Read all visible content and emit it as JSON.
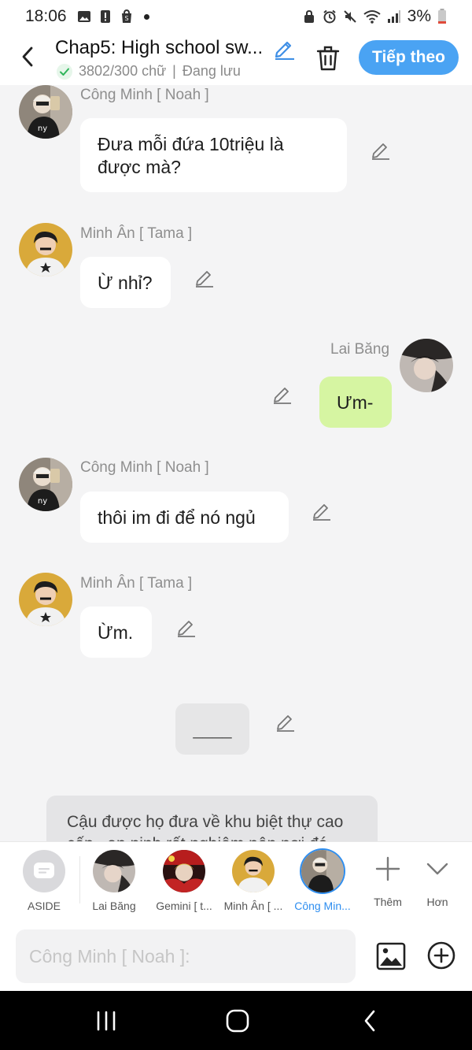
{
  "status_bar": {
    "time": "18:06",
    "battery": "3%"
  },
  "header": {
    "title": "Chap5: High school sw...",
    "word_count": "3802/300 chữ",
    "separator": "|",
    "save_status": "Đang lưu",
    "next_label": "Tiếp theo"
  },
  "messages": [
    {
      "sender": "Công Minh [ Noah ]",
      "text_line1": "Đưa mỗi đứa 10triệu là",
      "text_line2": "được mà?"
    },
    {
      "sender": "Minh Ân [ Tama ]",
      "text": "Ừ nhỉ?"
    },
    {
      "sender": "Lai Băng",
      "text": "Ưm-"
    },
    {
      "sender": "Công Minh [ Noah ]",
      "text": "thôi im đi để nó ngủ"
    },
    {
      "sender": "Minh Ân [ Tama ]",
      "text": "Ừm."
    },
    {
      "text": "____"
    }
  ],
  "aside": {
    "line1": "Cậu được họ đưa về khu biệt thự cao",
    "line2": "cấp , an ninh rất nghiêm nên nơi đó"
  },
  "characters": [
    {
      "label": "ASIDE"
    },
    {
      "label": "Lai Băng"
    },
    {
      "label": "Gemini [ t..."
    },
    {
      "label": "Minh Ân [ ..."
    },
    {
      "label": "Công Min..."
    }
  ],
  "tools": {
    "add_label": "Thêm",
    "more_label": "Hơn"
  },
  "input": {
    "placeholder": "Công Minh [ Noah ]:"
  },
  "colors": {
    "accent": "#4aa3f3",
    "right_bubble": "#d6f5a2",
    "active_character": "#2e8ef0"
  }
}
